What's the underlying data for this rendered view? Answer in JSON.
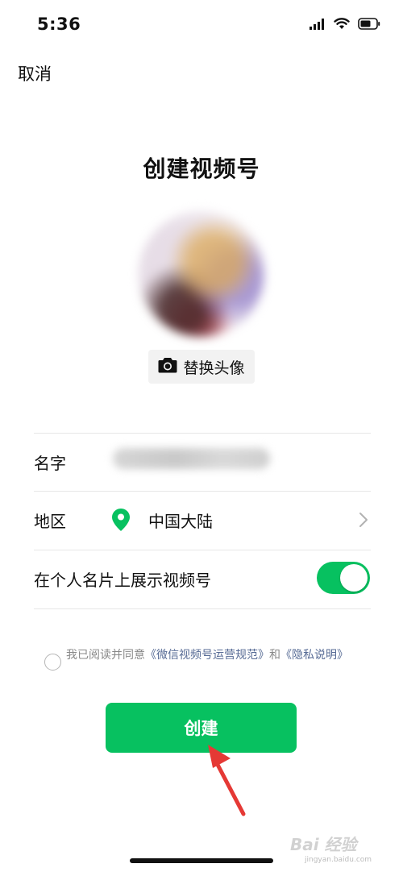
{
  "status_bar": {
    "time": "5:36"
  },
  "header": {
    "cancel_label": "取消",
    "title": "创建视频号"
  },
  "avatar": {
    "replace_label": "替换头像"
  },
  "form": {
    "name_label": "名字",
    "region_label": "地区",
    "region_value": "中国大陆",
    "show_on_card_label": "在个人名片上展示视频号",
    "show_on_card_enabled": true
  },
  "agreement": {
    "prefix": "我已阅读并同意",
    "link1": "《微信视频号运营规范》",
    "middle": "和",
    "link2": "《隐私说明》"
  },
  "create_button_label": "创建",
  "watermark": {
    "brand": "Bai 经验",
    "domain": "jingyan.baidu.com"
  },
  "colors": {
    "accent": "#07c160",
    "link": "#576b95",
    "annotation_arrow": "#e53935"
  }
}
